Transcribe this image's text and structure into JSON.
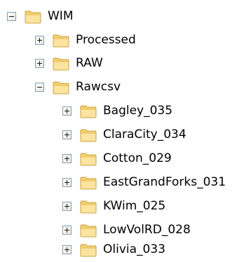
{
  "tree": {
    "root": {
      "label": "WIM",
      "state": "expanded",
      "icon": "folder-icon"
    },
    "children": [
      {
        "label": "Processed",
        "state": "collapsed",
        "icon": "folder-icon"
      },
      {
        "label": "RAW",
        "state": "collapsed",
        "icon": "folder-icon"
      },
      {
        "label": "Rawcsv",
        "state": "expanded",
        "icon": "folder-icon",
        "children": [
          {
            "label": "Bagley_035",
            "state": "collapsed",
            "icon": "folder-icon"
          },
          {
            "label": "ClaraCity_034",
            "state": "collapsed",
            "icon": "folder-icon"
          },
          {
            "label": "Cotton_029",
            "state": "collapsed",
            "icon": "folder-icon"
          },
          {
            "label": "EastGrandForks_031",
            "state": "collapsed",
            "icon": "folder-icon"
          },
          {
            "label": "KWim_025",
            "state": "collapsed",
            "icon": "folder-icon"
          },
          {
            "label": "LowVolRD_028",
            "state": "collapsed",
            "icon": "folder-icon"
          },
          {
            "label": "Olivia_033",
            "state": "collapsed",
            "icon": "folder-icon"
          }
        ]
      }
    ]
  },
  "colors": {
    "folder_fill": "#f6d77a",
    "folder_tab": "#fbe7a1",
    "folder_outline": "#c9a44a",
    "expander_border": "#7f9db9",
    "text": "#000000"
  }
}
